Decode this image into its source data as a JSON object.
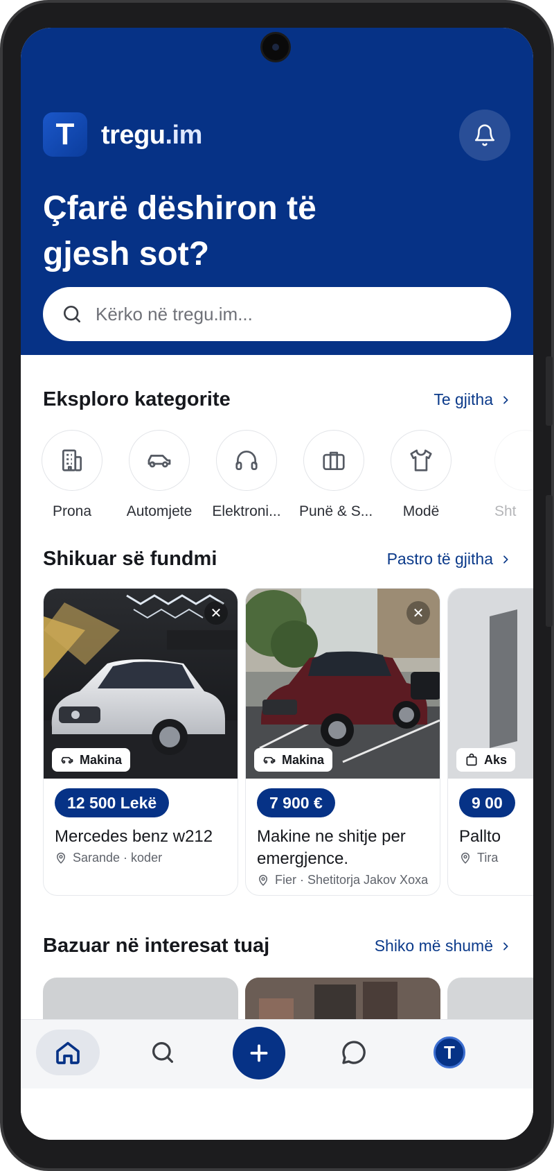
{
  "brand": {
    "logo_letter": "T",
    "name": "tregu",
    "suffix": ".im",
    "primary_color": "#063286"
  },
  "header": {
    "headline_line1": "Çfarë dëshiron të",
    "headline_line2": "gjesh sot?"
  },
  "search": {
    "placeholder": "Kërko në tregu.im..."
  },
  "categories_section": {
    "title": "Eksploro kategorite",
    "link": "Te gjitha",
    "items": [
      {
        "label": "Prona",
        "icon": "building-icon"
      },
      {
        "label": "Automjete",
        "icon": "car-icon"
      },
      {
        "label": "Elektroni...",
        "icon": "headphones-icon"
      },
      {
        "label": "Punë & S...",
        "icon": "briefcase-icon"
      },
      {
        "label": "Modë",
        "icon": "shirt-icon"
      },
      {
        "label": "Sht",
        "icon": "partial-icon"
      }
    ]
  },
  "recent_section": {
    "title": "Shikuar së fundmi",
    "link": "Pastro të gjitha",
    "items": [
      {
        "tag": "Makina",
        "price": "12 500 Lekë",
        "title": "Mercedes benz w212",
        "location": "Sarande · koder"
      },
      {
        "tag": "Makina",
        "price": "7 900 €",
        "title": "Makine ne shitje per emergjence.",
        "location": "Fier · Shetitorja Jakov Xoxa"
      },
      {
        "tag": "Aks",
        "price": "9 00",
        "title": "Pallto",
        "location": "Tira"
      }
    ]
  },
  "interests_section": {
    "title": "Bazuar në interesat tuaj",
    "link": "Shiko më shumë"
  },
  "nav": {
    "avatar_letter": "T"
  }
}
